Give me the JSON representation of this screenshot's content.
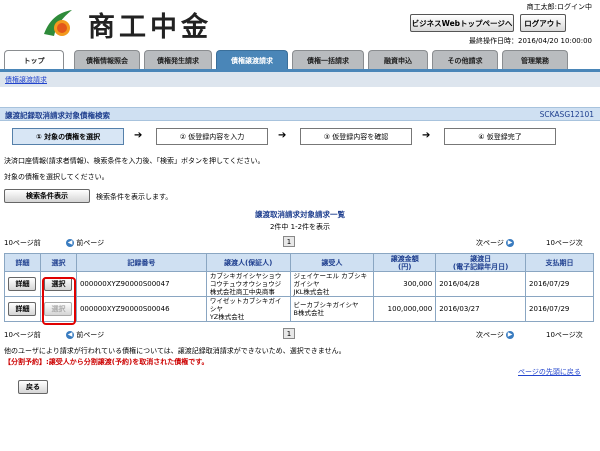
{
  "header": {
    "logo_text": "商工中金",
    "user": "商工太郎:ログイン中",
    "top_page_button": "ビジネスWebトップページへ",
    "logout_button": "ログアウト",
    "last_operation": "最終操作日時：2016/04/20 10:00:00"
  },
  "tabs": [
    "トップ",
    "債権情報照会",
    "債権発生請求",
    "債権譲渡請求",
    "債権一括請求",
    "融資申込",
    "その他請求",
    "管理業務"
  ],
  "active_tab": "債権譲渡請求",
  "subnav": {
    "link": "債権譲渡請求"
  },
  "page": {
    "title": "譲渡記録取消請求対象債権検索",
    "code": "SCKASG12101"
  },
  "steps": [
    "① 対象の債権を選択",
    "② 仮登録内容を入力",
    "③ 仮登録内容を確認",
    "④ 仮登録完了"
  ],
  "instructions": {
    "line1": "決済口座情報(請求者情報)、検索条件を入力後、「検索」ボタンを押してください。",
    "line2": "対象の債権を選択してください。"
  },
  "search_toggle": {
    "button": "検索条件表示",
    "note": "検索条件を表示します。"
  },
  "list": {
    "title": "譲渡取消請求対象請求一覧",
    "count": "2件中  1-2件を表示",
    "page": "1",
    "prev10": "10ページ前",
    "prev": "前ページ",
    "next": "次ページ",
    "next10": "10ページ次",
    "headers": [
      "詳細",
      "選択",
      "記録番号",
      "譲渡人(保証人)",
      "譲受人",
      "譲渡金額\n(円)",
      "譲渡日\n(電子記録年月日)",
      "支払期日"
    ],
    "rows": [
      {
        "detail": "詳細",
        "select": "選択",
        "record_no": "000000XYZ90000S00047",
        "transferor": "カブシキガイシヤショウコウチュウオウショウジ",
        "transferor2": "株式会社商工中央商事",
        "transferee": "ジェイケーエル カブシキガイシヤ",
        "transferee2": "JKL株式会社",
        "amount": "300,000",
        "date": "2016/04/28",
        "due": "2016/07/29",
        "select_enabled": true
      },
      {
        "detail": "詳細",
        "select": "選択",
        "record_no": "000000XYZ90000S00046",
        "transferor": "ワイゼットカブシキガイシヤ",
        "transferor2": "YZ株式会社",
        "transferee": "ビーカブシキガイシヤ",
        "transferee2": "B株式会社",
        "amount": "100,000,000",
        "date": "2016/03/27",
        "due": "2016/07/29",
        "select_enabled": false
      }
    ]
  },
  "notes": {
    "line1": "他のユーザにより請求が行われている債権については、譲渡記録取消請求ができないため、選択できません。",
    "line2": "【分割予約】:譲受人から分割譲渡(予約)を取消された債権です。"
  },
  "page_top_link": "ページの先頭に戻る",
  "back_button": "戻る"
}
